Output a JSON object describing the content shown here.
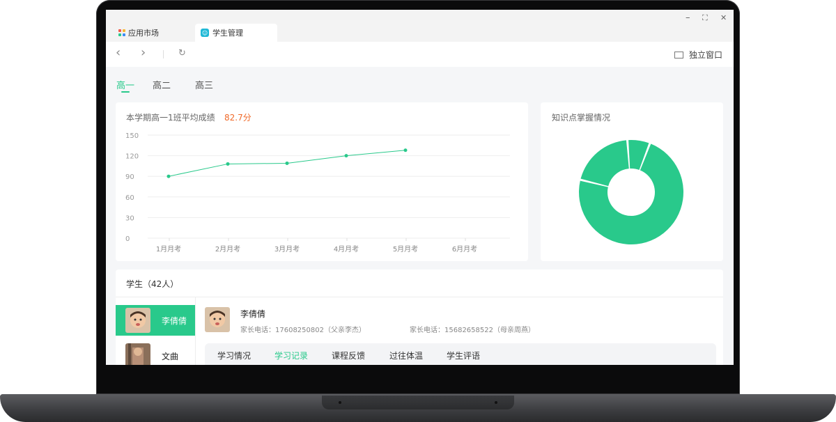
{
  "window": {
    "tabs": [
      {
        "label": "应用市场"
      },
      {
        "label": "学生管理"
      }
    ],
    "standalone_label": "独立窗口",
    "controls": {
      "minimize": "–",
      "maximize": "⛶",
      "close": "✕"
    }
  },
  "nav": {
    "back": "‹",
    "forward": "›",
    "refresh": "↻"
  },
  "grade_tabs": [
    {
      "label": "高一",
      "active": true
    },
    {
      "label": "高二",
      "active": false
    },
    {
      "label": "高三",
      "active": false
    }
  ],
  "score_card": {
    "title": "本学期高一1班平均成绩",
    "value": "82.7分"
  },
  "knowledge_card": {
    "title": "知识点掌握情况"
  },
  "chart_data": [
    {
      "type": "line",
      "title": "",
      "categories": [
        "1月月考",
        "2月月考",
        "3月月考",
        "4月月考",
        "5月月考",
        "6月月考"
      ],
      "values": [
        90,
        108,
        109,
        120,
        128,
        null
      ],
      "ylim": [
        0,
        150
      ],
      "yticks": [
        150,
        120,
        90,
        60,
        30,
        0
      ],
      "grid": true,
      "color": "#29c98b"
    },
    {
      "type": "pie",
      "title": "",
      "values": [
        73,
        20,
        7
      ],
      "color": "#29c98b"
    }
  ],
  "students": {
    "title": "学生（42人）",
    "list": [
      {
        "name": "李倩倩",
        "active": true
      },
      {
        "name": "文曲",
        "active": false
      }
    ],
    "detail": {
      "name": "李倩倩",
      "phone_father": "家长电话：17608250802（父亲李杰）",
      "phone_mother": "家长电话：15682658522（母亲周燕）"
    },
    "subtabs": [
      {
        "label": "学习情况",
        "active": false
      },
      {
        "label": "学习记录",
        "active": true
      },
      {
        "label": "课程反馈",
        "active": false
      },
      {
        "label": "过往体温",
        "active": false
      },
      {
        "label": "学生评语",
        "active": false
      }
    ]
  },
  "colors": {
    "accent": "#29c98b",
    "highlight": "#f06a2a"
  }
}
